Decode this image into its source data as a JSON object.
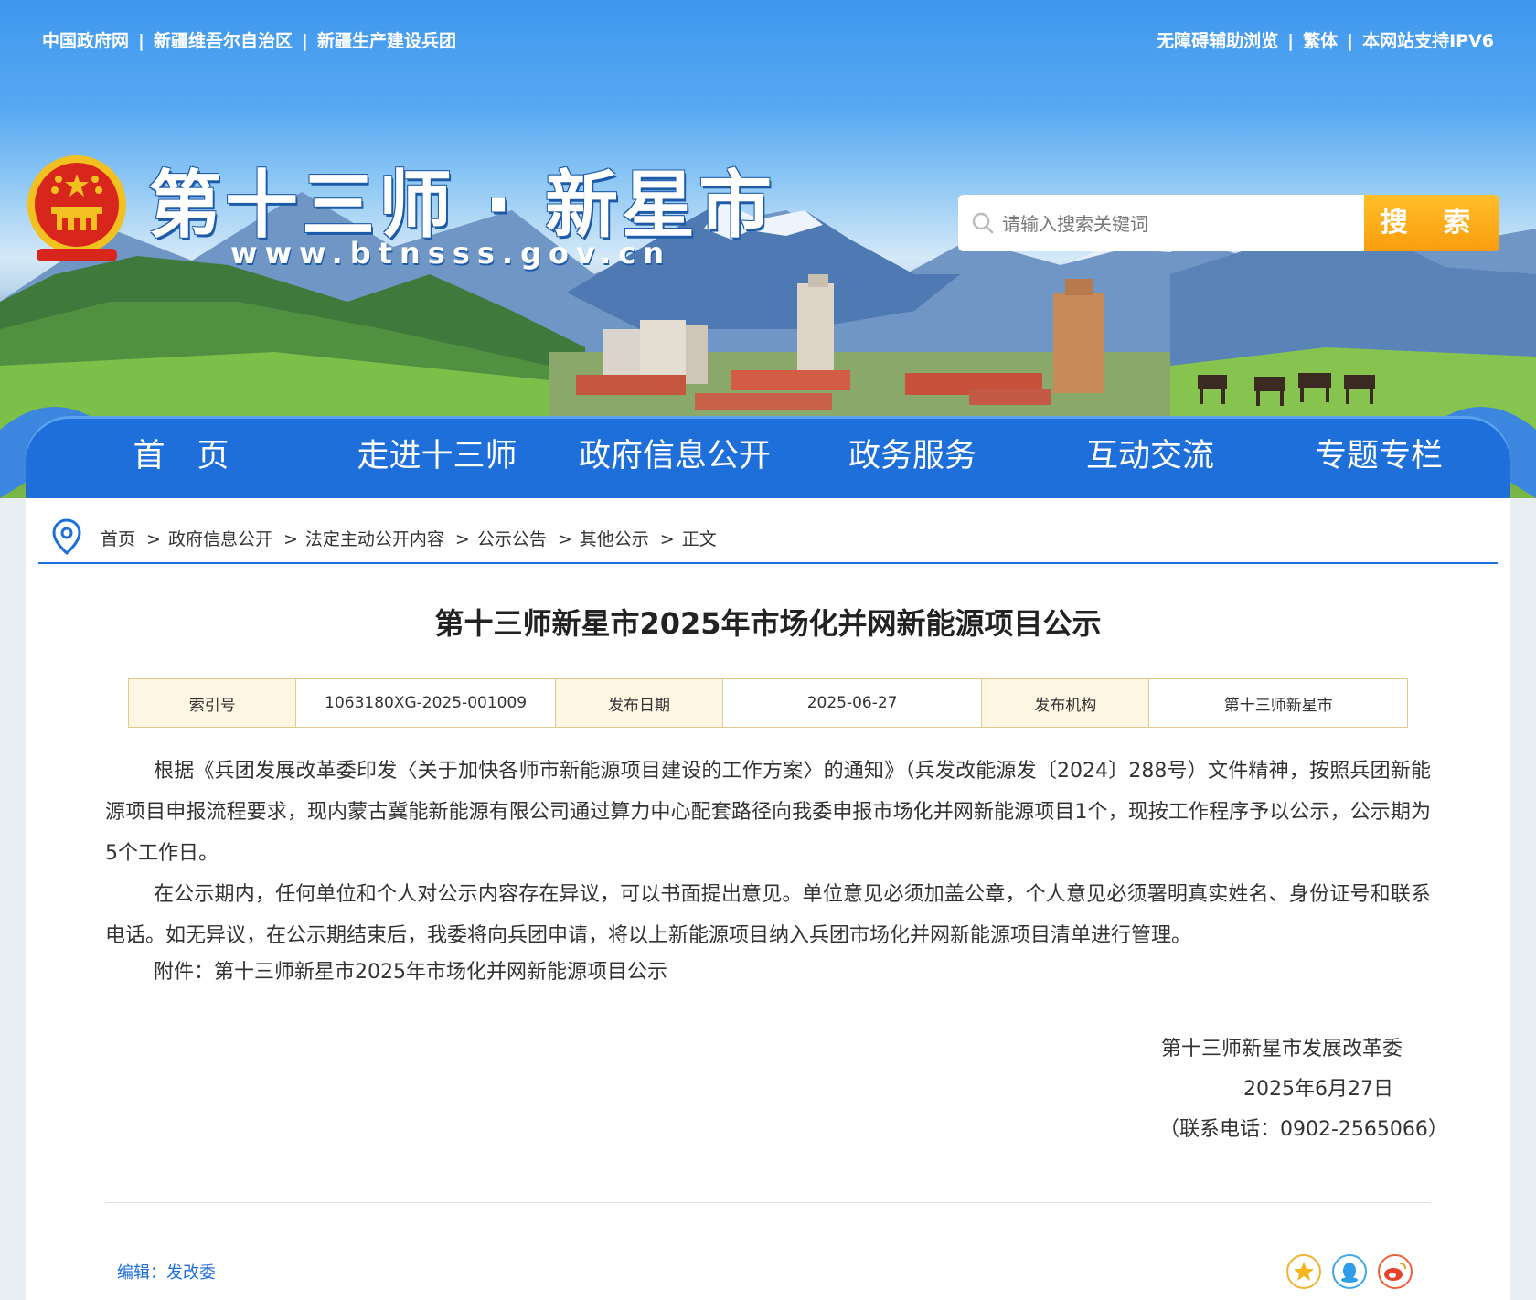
{
  "topbar": {
    "left_links": [
      "中国政府网",
      "新疆维吾尔自治区",
      "新疆生产建设兵团"
    ],
    "right_links": [
      "无障碍辅助浏览",
      "繁体",
      "本网站支持IPV6"
    ],
    "separator": "|"
  },
  "site": {
    "title": "第十三师 · 新星市",
    "url": "www.btnsss.gov.cn"
  },
  "search": {
    "placeholder": "请输入搜索关键词",
    "button_label": "搜 索"
  },
  "nav": [
    "首　页",
    "走进十三师",
    "政府信息公开",
    "政务服务",
    "互动交流",
    "专题专栏"
  ],
  "breadcrumb": [
    "首页",
    "政府信息公开",
    "法定主动公开内容",
    "公示公告",
    "其他公示",
    "正文"
  ],
  "breadcrumb_separator": ">",
  "article": {
    "title": "第十三师新星市2025年市场化并网新能源项目公示",
    "meta": {
      "index_label": "索引号",
      "index_value": "1063180XG-2025-001009",
      "date_label": "发布日期",
      "date_value": "2025-06-27",
      "org_label": "发布机构",
      "org_value": "第十三师新星市"
    },
    "paragraphs": [
      "根据《兵团发展改革委印发〈关于加快各师市新能源项目建设的工作方案〉的通知》（兵发改能源发〔2024〕288号）文件精神，按照兵团新能源项目申报流程要求，现内蒙古冀能新能源有限公司通过算力中心配套路径向我委申报市场化并网新能源项目1个，现按工作程序予以公示，公示期为5个工作日。",
      "在公示期内，任何单位和个人对公示内容存在异议，可以书面提出意见。单位意见必须加盖公章，个人意见必须署明真实姓名、身份证号和联系电话。如无异议，在公示期结束后，我委将向兵团申请，将以上新能源项目纳入兵团市场化并网新能源项目清单进行管理。"
    ],
    "attachment_label": "附件：",
    "attachment_name": "第十三师新星市2025年市场化并网新能源项目公示",
    "signature_org": "第十三师新星市发展改革委",
    "signature_date": "2025年6月27日",
    "contact": "（联系电话：0902-2565066）",
    "editor": "编辑：发改委"
  },
  "share_icons": [
    "favorite-icon",
    "qq-icon",
    "weibo-icon"
  ],
  "colors": {
    "nav_blue": "#1e6fd9",
    "search_orange": "#f9a81b",
    "meta_label_bg": "#fdf6e3",
    "meta_border": "#e3c98d"
  }
}
